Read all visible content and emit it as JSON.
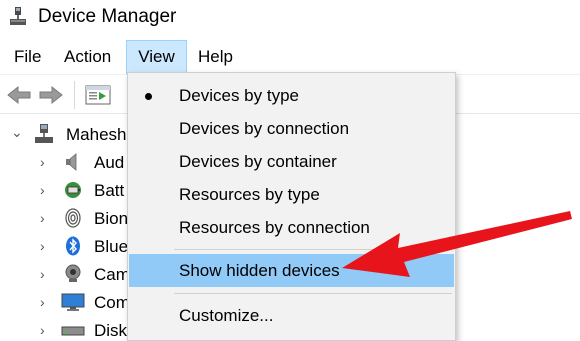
{
  "window": {
    "title": "Device Manager",
    "icon": "device-manager-icon"
  },
  "menubar": {
    "items": [
      {
        "label": "File"
      },
      {
        "label": "Action"
      },
      {
        "label": "View"
      },
      {
        "label": "Help"
      }
    ]
  },
  "toolbar": {
    "buttons": [
      "back-arrow-icon",
      "forward-arrow-icon",
      "properties-icon"
    ]
  },
  "tree": {
    "root": {
      "label": "Mahesh"
    },
    "items": [
      {
        "label": "Aud",
        "icon": "speaker-icon"
      },
      {
        "label": "Batt",
        "icon": "battery-icon"
      },
      {
        "label": "Bion",
        "icon": "fingerprint-icon"
      },
      {
        "label": "Blue",
        "icon": "bluetooth-icon"
      },
      {
        "label": "Cam",
        "icon": "camera-icon"
      },
      {
        "label": "Com",
        "icon": "monitor-icon"
      },
      {
        "label": "Disk",
        "icon": "disk-drive-icon"
      }
    ]
  },
  "view_menu": {
    "items": [
      {
        "label": "Devices by type",
        "checked": true
      },
      {
        "label": "Devices by connection"
      },
      {
        "label": "Devices by container"
      },
      {
        "label": "Resources by type"
      },
      {
        "label": "Resources by connection"
      },
      {
        "label": "Show hidden devices",
        "highlighted": true
      },
      {
        "label": "Customize..."
      }
    ]
  },
  "colors": {
    "highlight": "#91c9f7",
    "menu_active": "#cce8ff",
    "annotation_arrow": "#e8141c"
  }
}
